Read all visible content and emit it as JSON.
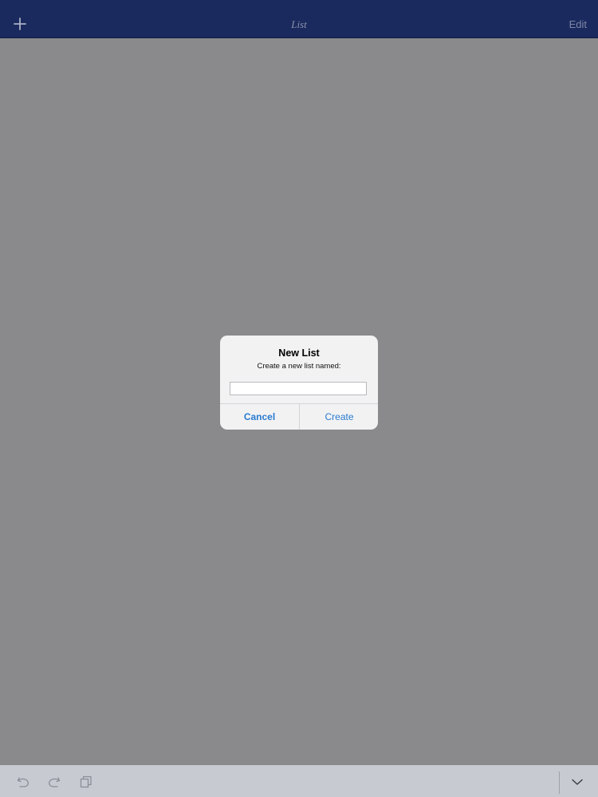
{
  "navbar": {
    "add_icon": "plus-icon",
    "title": "List",
    "edit_label": "Edit"
  },
  "alert": {
    "title": "New List",
    "message": "Create a new list named:",
    "input_value": "",
    "input_placeholder": "",
    "cancel_label": "Cancel",
    "create_label": "Create"
  },
  "toolbar": {
    "icons": [
      "undo-icon",
      "redo-icon",
      "copy-icon",
      "chevron-down-icon"
    ]
  },
  "colors": {
    "navbar_bg": "#1a2a5e",
    "dimmed_bg": "#8a898b",
    "toolbar_bg": "#c7cad1",
    "alert_bg": "#f2f2f3",
    "accent": "#2a7bd0"
  }
}
